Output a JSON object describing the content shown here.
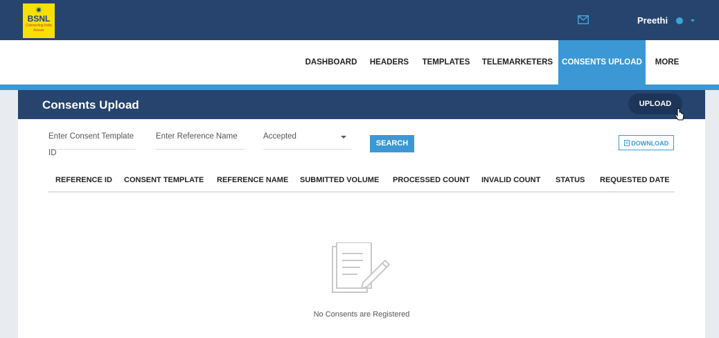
{
  "brand": {
    "name": "BSNL",
    "tagline": "Connecting India forever",
    "color": "#26446e",
    "accent": "#3b98d4",
    "logo_bg": "#f7e100"
  },
  "topbar": {
    "mail_icon": "mail-icon",
    "user_name": "Preethi",
    "user_icon": "user-avatar-icon",
    "dropdown_icon": "caret-down-icon"
  },
  "nav": {
    "items": [
      {
        "label": "DASHBOARD"
      },
      {
        "label": "HEADERS"
      },
      {
        "label": "TEMPLATES"
      },
      {
        "label": "TELEMARKETERS"
      },
      {
        "label": "CONSENTS UPLOAD",
        "active": true
      },
      {
        "label": "MORE"
      }
    ]
  },
  "panel": {
    "title": "Consents Upload",
    "upload_label": "UPLOAD"
  },
  "filters": {
    "template_id_placeholder": "Enter Consent Template ID",
    "reference_name_placeholder": "Enter Reference Name",
    "status_selected": "Accepted",
    "search_label": "SEARCH",
    "download_label": "DOWNLOAD",
    "download_icon": "document-icon"
  },
  "table": {
    "columns": [
      "REFERENCE ID",
      "CONSENT TEMPLATE",
      "REFERENCE NAME",
      "SUBMITTED VOLUME",
      "PROCESSED COUNT",
      "INVALID COUNT",
      "STATUS",
      "REQUESTED DATE"
    ],
    "rows": []
  },
  "empty_state": {
    "icon": "document-edit-icon",
    "message": "No Consents are Registered"
  }
}
